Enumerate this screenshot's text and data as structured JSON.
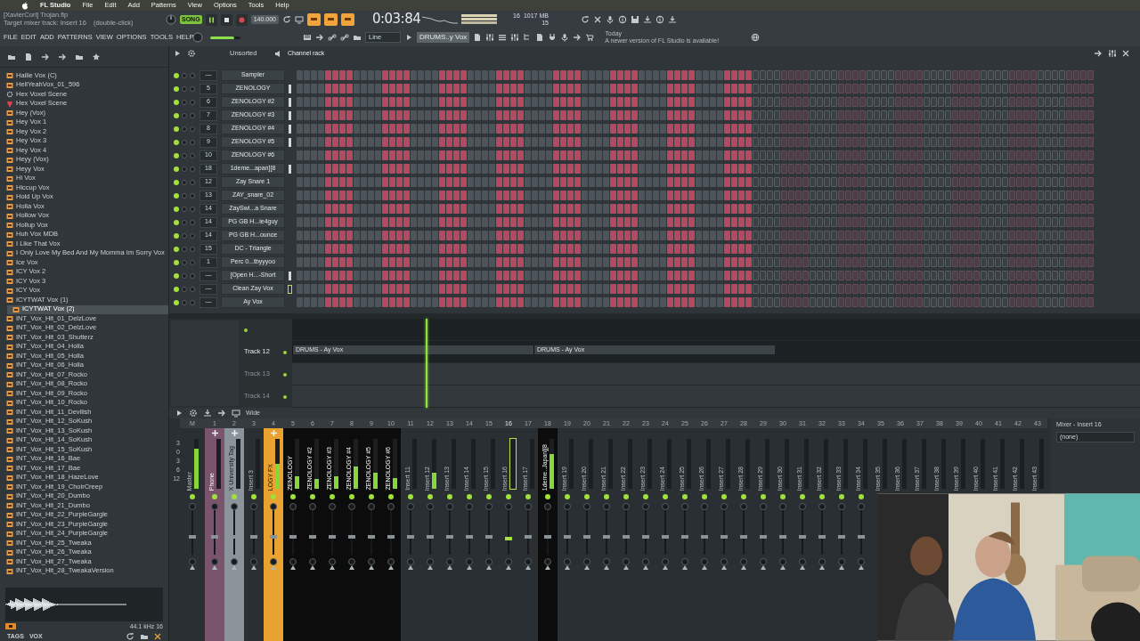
{
  "menu_bar": {
    "app": "FL Studio",
    "items": [
      "File",
      "Edit",
      "Add",
      "Patterns",
      "View",
      "Options",
      "Tools",
      "Help"
    ]
  },
  "toolbar": {
    "hint_title": "[XavierCori] Trojan.flp",
    "hint_text": "Target mixer track: Insert 16",
    "hint_action": "(double-click)",
    "menu": [
      "FILE",
      "EDIT",
      "ADD",
      "PATTERNS",
      "VIEW",
      "OPTIONS",
      "TOOLS",
      "HELP"
    ],
    "mode": "SONG",
    "tempo": "140.000",
    "time": "0:03:84",
    "polyphony": "16",
    "memory": "1017 MB",
    "cpu": "15",
    "master_volume": {
      "level": 0.8
    },
    "snap": "Line",
    "pattern": "DRUMS..y Vox",
    "news_title": "Today",
    "news_text": "A newer version of FL Studio is available!"
  },
  "browser": {
    "items": [
      {
        "label": "Hailie Vox (C)",
        "kind": "audio",
        "selected": false
      },
      {
        "label": "HellYeahVox_01_596",
        "kind": "audio",
        "selected": false
      },
      {
        "label": "Hex Voxel Scene",
        "kind": "preset",
        "selected": false
      },
      {
        "label": "Hex Voxel Scene",
        "kind": "plugin",
        "selected": false
      },
      {
        "label": "Hey (Vox)",
        "kind": "audio",
        "selected": false
      },
      {
        "label": "Hey Vox 1",
        "kind": "audio",
        "selected": false
      },
      {
        "label": "Hey Vox 2",
        "kind": "audio",
        "selected": false
      },
      {
        "label": "Hey Vox 3",
        "kind": "audio",
        "selected": false
      },
      {
        "label": "Hey Vox 4",
        "kind": "audio",
        "selected": false
      },
      {
        "label": "Heyy (Vox)",
        "kind": "audio",
        "selected": false
      },
      {
        "label": "Heyy Vox",
        "kind": "audio",
        "selected": false
      },
      {
        "label": "Hi Vox",
        "kind": "audio",
        "selected": false
      },
      {
        "label": "Hiccup Vox",
        "kind": "audio",
        "selected": false
      },
      {
        "label": "Hold Up Vox",
        "kind": "audio",
        "selected": false
      },
      {
        "label": "Holla Vox",
        "kind": "audio",
        "selected": false
      },
      {
        "label": "Hollow Vox",
        "kind": "audio",
        "selected": false
      },
      {
        "label": "Hollup Vox",
        "kind": "audio",
        "selected": false
      },
      {
        "label": "Huh Vox MDB",
        "kind": "audio",
        "selected": false
      },
      {
        "label": "I Like That Vox",
        "kind": "audio",
        "selected": false
      },
      {
        "label": "I Only Love My Bed And My Momma Im Sorry Vox",
        "kind": "audio",
        "selected": false
      },
      {
        "label": "Ice Vox",
        "kind": "audio",
        "selected": false
      },
      {
        "label": "ICY Vox 2",
        "kind": "audio",
        "selected": false
      },
      {
        "label": "ICY Vox 3",
        "kind": "audio",
        "selected": false
      },
      {
        "label": "ICY Vox",
        "kind": "audio",
        "selected": false
      },
      {
        "label": "ICYTWAT Vox (1)",
        "kind": "audio",
        "selected": false
      },
      {
        "label": "ICYTWAT Vox (2)",
        "kind": "audio",
        "selected": true
      },
      {
        "label": "INT_Vox_Hit_01_DelzLove",
        "kind": "audio",
        "selected": false
      },
      {
        "label": "INT_Vox_Hit_02_DelzLove",
        "kind": "audio",
        "selected": false
      },
      {
        "label": "INT_Vox_Hit_03_Shutterz",
        "kind": "audio",
        "selected": false
      },
      {
        "label": "INT_Vox_Hit_04_Holla",
        "kind": "audio",
        "selected": false
      },
      {
        "label": "INT_Vox_Hit_05_Holla",
        "kind": "audio",
        "selected": false
      },
      {
        "label": "INT_Vox_Hit_06_Holla",
        "kind": "audio",
        "selected": false
      },
      {
        "label": "INT_Vox_Hit_07_Rocko",
        "kind": "audio",
        "selected": false
      },
      {
        "label": "INT_Vox_Hit_08_Rocko",
        "kind": "audio",
        "selected": false
      },
      {
        "label": "INT_Vox_Hit_09_Rocko",
        "kind": "audio",
        "selected": false
      },
      {
        "label": "INT_Vox_Hit_10_Rocko",
        "kind": "audio",
        "selected": false
      },
      {
        "label": "INT_Vox_Hit_11_Devilish",
        "kind": "audio",
        "selected": false
      },
      {
        "label": "INT_Vox_Hit_12_SoKush",
        "kind": "audio",
        "selected": false
      },
      {
        "label": "INT_Vox_Hit_13_SoKush",
        "kind": "audio",
        "selected": false
      },
      {
        "label": "INT_Vox_Hit_14_SoKush",
        "kind": "audio",
        "selected": false
      },
      {
        "label": "INT_Vox_Hit_15_SoKush",
        "kind": "audio",
        "selected": false
      },
      {
        "label": "INT_Vox_Hit_16_Bae",
        "kind": "audio",
        "selected": false
      },
      {
        "label": "INT_Vox_Hit_17_Bae",
        "kind": "audio",
        "selected": false
      },
      {
        "label": "INT_Vox_Hit_18_HazeLove",
        "kind": "audio",
        "selected": false
      },
      {
        "label": "INT_Vox_Hit_19_ChoirCreep",
        "kind": "audio",
        "selected": false
      },
      {
        "label": "INT_Vox_Hit_20_Dumbo",
        "kind": "audio",
        "selected": false
      },
      {
        "label": "INT_Vox_Hit_21_Dumbo",
        "kind": "audio",
        "selected": false
      },
      {
        "label": "INT_Vox_Hit_22_PurpleGargle",
        "kind": "audio",
        "selected": false
      },
      {
        "label": "INT_Vox_Hit_23_PurpleGargle",
        "kind": "audio",
        "selected": false
      },
      {
        "label": "INT_Vox_Hit_24_PurpleGargle",
        "kind": "audio",
        "selected": false
      },
      {
        "label": "INT_Vox_Hit_25_Tweaka",
        "kind": "audio",
        "selected": false
      },
      {
        "label": "INT_Vox_Hit_26_Tweaka",
        "kind": "audio",
        "selected": false
      },
      {
        "label": "INT_Vox_Hit_27_Tweaka",
        "kind": "audio",
        "selected": false
      },
      {
        "label": "INT_Vox_Hit_28_TweakaVersion",
        "kind": "audio",
        "selected": false
      }
    ],
    "sample_info": "44.1 kHz 16",
    "tags_label": "TAGS",
    "tag": "VOX"
  },
  "channel_rack": {
    "filter": "Unsorted",
    "title": "Channel rack",
    "channels": [
      {
        "number": "—",
        "name": "Sampler",
        "selected": false,
        "marked": false,
        "steps": [
          false,
          false,
          false,
          false,
          true,
          true,
          true,
          true,
          false,
          false,
          false,
          false,
          true,
          true,
          true,
          true,
          false,
          false,
          false,
          false,
          true,
          true,
          true,
          true,
          false,
          false,
          false,
          false,
          true,
          true,
          true,
          true,
          false,
          false,
          false,
          false,
          true,
          true,
          true,
          true,
          false,
          false,
          false,
          false,
          true,
          true,
          true,
          true,
          false,
          false,
          false,
          false,
          true,
          true,
          true,
          true,
          false,
          false,
          false,
          false,
          true,
          true,
          true,
          true
        ]
      },
      {
        "number": "5",
        "name": "ZENOLOGY",
        "selected": false,
        "marked": true,
        "steps": [
          false,
          false,
          false,
          false,
          true,
          true,
          true,
          true,
          false,
          false,
          false,
          false,
          true,
          true,
          true,
          true,
          false,
          false,
          false,
          false,
          true,
          true,
          true,
          true,
          false,
          false,
          false,
          false,
          true,
          true,
          true,
          true,
          false,
          false,
          false,
          false,
          true,
          true,
          true,
          true,
          false,
          false,
          false,
          false,
          true,
          true,
          true,
          true,
          false,
          false,
          false,
          false,
          true,
          true,
          true,
          true,
          false,
          false,
          false,
          false,
          true,
          true,
          true,
          true
        ]
      },
      {
        "number": "6",
        "name": "ZENOLOGY #2",
        "selected": false,
        "marked": true,
        "steps": [
          false,
          false,
          false,
          false,
          true,
          true,
          true,
          true,
          false,
          false,
          false,
          false,
          true,
          true,
          true,
          true,
          false,
          false,
          false,
          false,
          true,
          true,
          true,
          true,
          false,
          false,
          false,
          false,
          true,
          true,
          true,
          true,
          false,
          false,
          false,
          false,
          true,
          true,
          true,
          true,
          false,
          false,
          false,
          false,
          true,
          true,
          true,
          true,
          false,
          false,
          false,
          false,
          true,
          true,
          true,
          true,
          false,
          false,
          false,
          false,
          true,
          true,
          true,
          true
        ]
      },
      {
        "number": "7",
        "name": "ZENOLOGY #3",
        "selected": false,
        "marked": true,
        "steps": [
          false,
          false,
          false,
          false,
          true,
          true,
          true,
          true,
          false,
          false,
          false,
          false,
          true,
          true,
          true,
          true,
          false,
          false,
          false,
          false,
          true,
          true,
          true,
          true,
          false,
          false,
          false,
          false,
          true,
          true,
          true,
          true,
          false,
          false,
          false,
          false,
          true,
          true,
          true,
          true,
          false,
          false,
          false,
          false,
          true,
          true,
          true,
          true,
          false,
          false,
          false,
          false,
          true,
          true,
          true,
          true,
          false,
          false,
          false,
          false,
          true,
          true,
          true,
          true
        ]
      },
      {
        "number": "8",
        "name": "ZENOLOGY #4",
        "selected": false,
        "marked": true,
        "steps": [
          false,
          false,
          false,
          false,
          true,
          true,
          true,
          true,
          false,
          false,
          false,
          false,
          true,
          true,
          true,
          true,
          false,
          false,
          false,
          false,
          true,
          true,
          true,
          true,
          false,
          false,
          false,
          false,
          true,
          true,
          true,
          true,
          false,
          false,
          false,
          false,
          true,
          true,
          true,
          true,
          false,
          false,
          false,
          false,
          true,
          true,
          true,
          true,
          false,
          false,
          false,
          false,
          true,
          true,
          true,
          true,
          false,
          false,
          false,
          false,
          true,
          true,
          true,
          true
        ]
      },
      {
        "number": "9",
        "name": "ZENOLOGY #5",
        "selected": false,
        "marked": true,
        "steps": [
          false,
          false,
          false,
          false,
          true,
          true,
          true,
          true,
          false,
          false,
          false,
          false,
          true,
          true,
          true,
          true,
          false,
          false,
          false,
          false,
          true,
          true,
          true,
          true,
          false,
          false,
          false,
          false,
          true,
          true,
          true,
          true,
          false,
          false,
          false,
          false,
          true,
          true,
          true,
          true,
          false,
          false,
          false,
          false,
          true,
          true,
          true,
          true,
          false,
          false,
          false,
          false,
          true,
          true,
          true,
          true,
          false,
          false,
          false,
          false,
          true,
          true,
          true,
          true
        ]
      },
      {
        "number": "10",
        "name": "ZENOLOGY #6",
        "selected": false,
        "marked": false,
        "steps": [
          false,
          false,
          false,
          false,
          true,
          true,
          true,
          true,
          false,
          false,
          false,
          false,
          true,
          true,
          true,
          true,
          false,
          false,
          false,
          false,
          true,
          true,
          true,
          true,
          false,
          false,
          false,
          false,
          true,
          true,
          true,
          true,
          false,
          false,
          false,
          false,
          true,
          true,
          true,
          true,
          false,
          false,
          false,
          false,
          true,
          true,
          true,
          true,
          false,
          false,
          false,
          false,
          true,
          true,
          true,
          true,
          false,
          false,
          false,
          false,
          true,
          true,
          true,
          true
        ]
      },
      {
        "number": "18",
        "name": "1deme...apan][8",
        "selected": false,
        "marked": true,
        "steps": [
          false,
          false,
          false,
          false,
          true,
          true,
          true,
          true,
          false,
          false,
          false,
          false,
          true,
          true,
          true,
          true,
          false,
          false,
          false,
          false,
          true,
          true,
          true,
          true,
          false,
          false,
          false,
          false,
          true,
          true,
          true,
          true,
          false,
          false,
          false,
          false,
          true,
          true,
          true,
          true,
          false,
          false,
          false,
          false,
          true,
          true,
          true,
          true,
          false,
          false,
          false,
          false,
          true,
          true,
          true,
          true,
          false,
          false,
          false,
          false,
          true,
          true,
          true,
          true
        ]
      },
      {
        "number": "12",
        "name": "Zay Snare 1",
        "selected": false,
        "marked": false,
        "steps": [
          false,
          false,
          false,
          false,
          true,
          true,
          true,
          true,
          false,
          false,
          false,
          false,
          true,
          true,
          true,
          true,
          false,
          false,
          false,
          false,
          true,
          true,
          true,
          true,
          false,
          false,
          false,
          false,
          true,
          true,
          true,
          true,
          false,
          false,
          false,
          false,
          true,
          true,
          true,
          true,
          false,
          false,
          false,
          false,
          true,
          true,
          true,
          true,
          false,
          false,
          false,
          false,
          true,
          true,
          true,
          true,
          false,
          false,
          false,
          false,
          true,
          true,
          true,
          true
        ]
      },
      {
        "number": "13",
        "name": "ZAY_snare_02",
        "selected": false,
        "marked": false,
        "steps": [
          false,
          false,
          false,
          false,
          true,
          true,
          true,
          true,
          false,
          false,
          false,
          false,
          true,
          true,
          true,
          true,
          false,
          false,
          false,
          false,
          true,
          true,
          true,
          true,
          false,
          false,
          false,
          false,
          true,
          true,
          true,
          true,
          false,
          false,
          false,
          false,
          true,
          true,
          true,
          true,
          false,
          false,
          false,
          false,
          true,
          true,
          true,
          true,
          false,
          false,
          false,
          false,
          true,
          true,
          true,
          true,
          false,
          false,
          false,
          false,
          true,
          true,
          true,
          true
        ]
      },
      {
        "number": "14",
        "name": "ZaySwi...a Snare",
        "selected": false,
        "marked": false,
        "steps": [
          false,
          false,
          false,
          false,
          true,
          true,
          true,
          true,
          false,
          false,
          false,
          false,
          true,
          true,
          true,
          true,
          false,
          false,
          false,
          false,
          true,
          true,
          true,
          true,
          false,
          false,
          false,
          false,
          true,
          true,
          true,
          true,
          false,
          false,
          false,
          false,
          true,
          true,
          true,
          true,
          false,
          false,
          false,
          false,
          true,
          true,
          true,
          true,
          false,
          false,
          false,
          false,
          true,
          true,
          true,
          true,
          false,
          false,
          false,
          false,
          true,
          true,
          true,
          true
        ]
      },
      {
        "number": "14",
        "name": "PG GB H...ie4guy",
        "selected": false,
        "marked": false,
        "steps": [
          false,
          false,
          false,
          false,
          true,
          true,
          true,
          true,
          false,
          false,
          false,
          false,
          true,
          true,
          true,
          true,
          false,
          false,
          false,
          false,
          true,
          true,
          true,
          true,
          false,
          false,
          false,
          false,
          true,
          true,
          true,
          true,
          false,
          false,
          false,
          false,
          true,
          true,
          true,
          true,
          false,
          false,
          false,
          false,
          true,
          true,
          true,
          true,
          false,
          false,
          false,
          false,
          true,
          true,
          true,
          true,
          false,
          false,
          false,
          false,
          true,
          true,
          true,
          true
        ]
      },
      {
        "number": "14",
        "name": "PG GB H...ounce",
        "selected": false,
        "marked": false,
        "steps": [
          false,
          false,
          false,
          false,
          true,
          true,
          true,
          true,
          false,
          false,
          false,
          false,
          true,
          true,
          true,
          true,
          false,
          false,
          false,
          false,
          true,
          true,
          true,
          true,
          false,
          false,
          false,
          false,
          true,
          true,
          true,
          true,
          false,
          false,
          false,
          false,
          true,
          true,
          true,
          true,
          false,
          false,
          false,
          false,
          true,
          true,
          true,
          true,
          false,
          false,
          false,
          false,
          true,
          true,
          true,
          true,
          false,
          false,
          false,
          false,
          true,
          true,
          true,
          true
        ]
      },
      {
        "number": "15",
        "name": "DC - Triangle",
        "selected": false,
        "marked": false,
        "steps": [
          false,
          false,
          false,
          false,
          true,
          true,
          true,
          true,
          false,
          false,
          false,
          false,
          true,
          true,
          true,
          true,
          false,
          false,
          false,
          false,
          true,
          true,
          true,
          true,
          false,
          false,
          false,
          false,
          true,
          true,
          true,
          true,
          false,
          false,
          false,
          false,
          true,
          true,
          true,
          true,
          false,
          false,
          false,
          false,
          true,
          true,
          true,
          true,
          false,
          false,
          false,
          false,
          true,
          true,
          true,
          true,
          false,
          false,
          false,
          false,
          true,
          true,
          true,
          true
        ]
      },
      {
        "number": "1",
        "name": "Perc 0...tbyyyoo",
        "selected": false,
        "marked": false,
        "steps": [
          false,
          false,
          false,
          false,
          true,
          true,
          true,
          true,
          false,
          false,
          false,
          false,
          true,
          true,
          true,
          true,
          false,
          false,
          false,
          false,
          true,
          true,
          true,
          true,
          false,
          false,
          false,
          false,
          true,
          true,
          true,
          true,
          false,
          false,
          false,
          false,
          true,
          true,
          true,
          true,
          false,
          false,
          false,
          false,
          true,
          true,
          true,
          true,
          false,
          false,
          false,
          false,
          true,
          true,
          true,
          true,
          false,
          false,
          false,
          false,
          true,
          true,
          true,
          true
        ]
      },
      {
        "number": "—",
        "name": "[Open H...-Short",
        "selected": false,
        "marked": true,
        "steps": [
          false,
          false,
          false,
          false,
          true,
          true,
          true,
          true,
          false,
          false,
          false,
          false,
          true,
          true,
          true,
          true,
          false,
          false,
          false,
          false,
          true,
          true,
          true,
          true,
          false,
          false,
          false,
          false,
          true,
          true,
          true,
          true,
          false,
          false,
          false,
          false,
          true,
          true,
          true,
          true,
          false,
          false,
          false,
          false,
          true,
          true,
          true,
          true,
          false,
          false,
          false,
          false,
          true,
          true,
          true,
          true,
          false,
          false,
          false,
          false,
          true,
          true,
          true,
          true
        ]
      },
      {
        "number": "—",
        "name": "Clean Zay Vox",
        "selected": true,
        "marked": false,
        "steps": [
          false,
          false,
          false,
          false,
          true,
          true,
          true,
          true,
          false,
          false,
          false,
          false,
          true,
          true,
          true,
          true,
          false,
          false,
          false,
          false,
          true,
          true,
          true,
          true,
          false,
          false,
          false,
          false,
          true,
          true,
          true,
          true,
          false,
          false,
          false,
          false,
          true,
          true,
          true,
          true,
          false,
          false,
          false,
          false,
          true,
          true,
          true,
          true,
          false,
          false,
          false,
          false,
          true,
          true,
          true,
          true,
          false,
          false,
          false,
          false,
          true,
          true,
          true,
          true
        ]
      },
      {
        "number": "—",
        "name": "Ay Vox",
        "selected": false,
        "marked": false,
        "steps": [
          false,
          false,
          false,
          false,
          true,
          true,
          true,
          true,
          false,
          false,
          false,
          false,
          true,
          true,
          true,
          true,
          false,
          false,
          false,
          false,
          true,
          true,
          true,
          true,
          false,
          false,
          false,
          false,
          true,
          true,
          true,
          true,
          false,
          false,
          false,
          false,
          true,
          true,
          true,
          true,
          false,
          false,
          false,
          false,
          true,
          true,
          true,
          true,
          false,
          false,
          false,
          false,
          true,
          true,
          true,
          true,
          false,
          false,
          false,
          false,
          true,
          true,
          true,
          true
        ]
      }
    ]
  },
  "playlist": {
    "playhead": {
      "level": 0.158
    },
    "tracks": [
      {
        "name": "Track 12",
        "empty": false,
        "clips": [
          "DRUMS - Ay Vox",
          "DRUMS - Ay Vox"
        ]
      },
      {
        "name": "Track 13",
        "empty": true
      },
      {
        "name": "Track 14",
        "empty": true
      }
    ]
  },
  "mixer": {
    "view": "Wide",
    "scale": [
      "3",
      "0",
      "3",
      "6",
      "12"
    ],
    "master": {
      "number": "M",
      "name": "Master",
      "level": 0.8
    },
    "strips": [
      {
        "number": "1",
        "name": "Phone",
        "selected": false,
        "color": "#7a546c"
      },
      {
        "number": "2",
        "name": "X University Tag",
        "selected": false,
        "color": "#8b949b"
      },
      {
        "number": "3",
        "name": "Insert 3",
        "selected": false
      },
      {
        "number": "4",
        "name": "LOGY FX",
        "selected": false,
        "color": "#e9a22f",
        "level": 0.5
      },
      {
        "number": "5",
        "name": "ZENOLOGY",
        "selected": false,
        "color": "#0c0c0c",
        "level": 0.25
      },
      {
        "number": "6",
        "name": "ZENOLOGY #2",
        "selected": false,
        "color": "#0c0c0c",
        "level": 0.2
      },
      {
        "number": "7",
        "name": "ZENOLOGY #3",
        "selected": false,
        "color": "#0c0c0c",
        "level": 0.25
      },
      {
        "number": "8",
        "name": "ZENOLOGY #4",
        "selected": false,
        "color": "#0c0c0c",
        "level": 0.45
      },
      {
        "number": "9",
        "name": "ZENOLOGY #5",
        "selected": false,
        "color": "#0c0c0c",
        "level": 0.33
      },
      {
        "number": "10",
        "name": "ZENOLOGY #6",
        "selected": false,
        "color": "#0c0c0c",
        "level": 0.22
      },
      {
        "number": "11",
        "name": "Insert 11",
        "selected": false
      },
      {
        "number": "12",
        "name": "Insert 12",
        "selected": false,
        "level": 0.33
      },
      {
        "number": "13",
        "name": "Insert 13",
        "selected": false
      },
      {
        "number": "14",
        "name": "Insert 14",
        "selected": false
      },
      {
        "number": "15",
        "name": "Insert 15",
        "selected": false
      },
      {
        "number": "16",
        "name": "Insert 16",
        "selected": true
      },
      {
        "number": "17",
        "name": "Insert 17",
        "selected": false
      },
      {
        "number": "18",
        "name": "1deme..Japan][8",
        "selected": false,
        "color": "#0c0c0c",
        "level": 0.7
      },
      {
        "number": "19",
        "name": "Insert 19",
        "selected": false
      },
      {
        "number": "20",
        "name": "Insert 20",
        "selected": false
      },
      {
        "number": "21",
        "name": "Insert 21",
        "selected": false
      },
      {
        "number": "22",
        "name": "Insert 22",
        "selected": false
      },
      {
        "number": "23",
        "name": "Insert 23",
        "selected": false
      },
      {
        "number": "24",
        "name": "Insert 24",
        "selected": false
      },
      {
        "number": "25",
        "name": "Insert 25",
        "selected": false
      },
      {
        "number": "26",
        "name": "Insert 26",
        "selected": false
      },
      {
        "number": "27",
        "name": "Insert 27",
        "selected": false
      },
      {
        "number": "28",
        "name": "Insert 28",
        "selected": false
      },
      {
        "number": "29",
        "name": "Insert 29",
        "selected": false
      },
      {
        "number": "30",
        "name": "Insert 30",
        "selected": false
      },
      {
        "number": "31",
        "name": "Insert 31",
        "selected": false
      },
      {
        "number": "32",
        "name": "Insert 32",
        "selected": false
      },
      {
        "number": "33",
        "name": "Insert 33",
        "selected": false
      },
      {
        "number": "34",
        "name": "Insert 34",
        "selected": false
      },
      {
        "number": "35",
        "name": "Insert 35",
        "selected": false
      },
      {
        "number": "36",
        "name": "Insert 36",
        "selected": false
      },
      {
        "number": "37",
        "name": "Insert 37",
        "selected": false
      },
      {
        "number": "38",
        "name": "Insert 38",
        "selected": false
      },
      {
        "number": "39",
        "name": "Insert 39",
        "selected": false
      },
      {
        "number": "40",
        "name": "Insert 40",
        "selected": false
      },
      {
        "number": "41",
        "name": "Insert 41",
        "selected": false
      },
      {
        "number": "42",
        "name": "Insert 42",
        "selected": false
      },
      {
        "number": "43",
        "name": "Insert 43",
        "selected": false
      }
    ],
    "panel_title": "Mixer - Insert 16",
    "input": "(none)"
  }
}
